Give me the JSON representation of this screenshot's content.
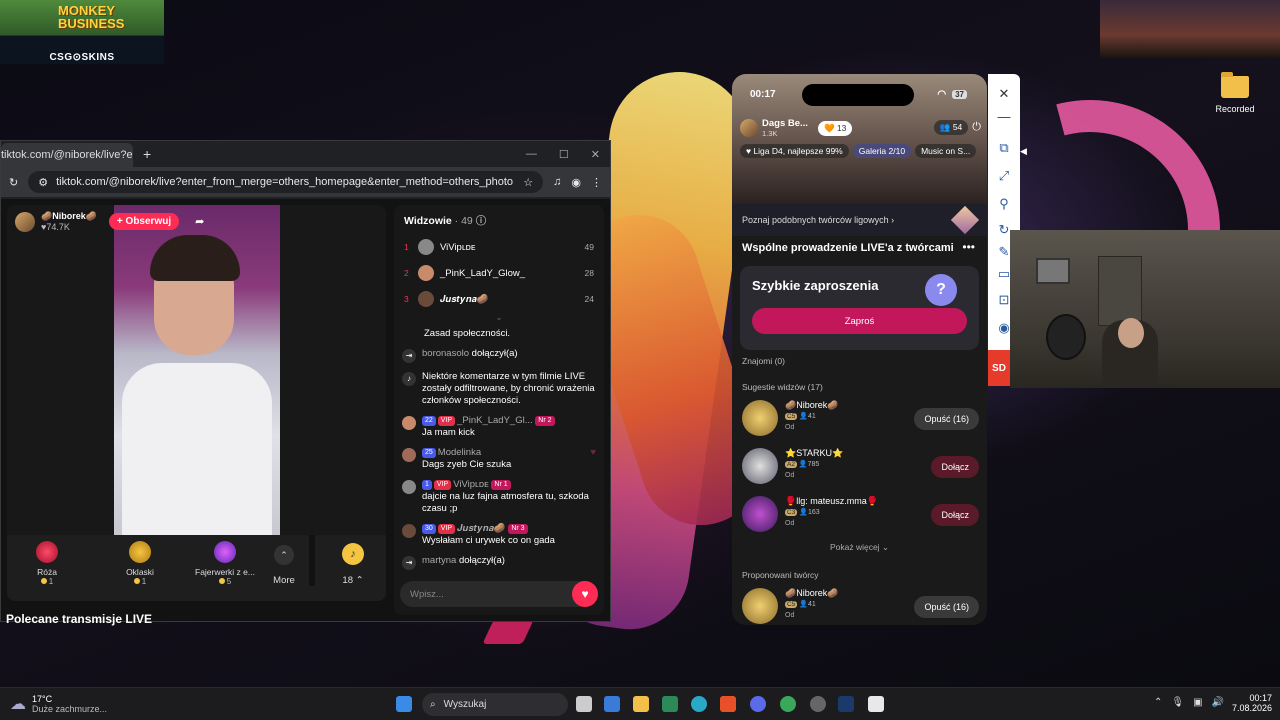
{
  "thumb_top_left": {
    "title_line1": "MONKEY",
    "title_line2": "BUSINESS",
    "brand": "CSG⊙SKINS"
  },
  "desktop_icon": {
    "label": "Recorded"
  },
  "browser": {
    "tab_title": "tiktok.com/@niborek/live?e",
    "new_tab": "+",
    "window_controls": [
      "—",
      "☐",
      "✕"
    ],
    "url": "tiktok.com/@niborek/live?enter_from_merge=others_homepage&enter_method=others_photo"
  },
  "live": {
    "host_name": "🥔Niborek🥔",
    "host_likes": "♥74.7K",
    "follow_label": "+ Obserwuj",
    "gifts": [
      {
        "name": "Róża",
        "cost": "1"
      },
      {
        "name": "Oklaski",
        "cost": "1"
      },
      {
        "name": "Fajerwerki z e...",
        "cost": "5"
      }
    ],
    "more_label": "More",
    "coins": "18",
    "recommended_label": "Polecane transmisje LIVE"
  },
  "chat": {
    "header": "Widzowie",
    "viewer_count": "· 49",
    "top_viewers": [
      {
        "rank": "1",
        "name": "ViVipʟᴅᴇ",
        "value": "49"
      },
      {
        "rank": "2",
        "name": "_PinK_LadY_Glow_",
        "value": "28"
      },
      {
        "rank": "3",
        "name": "𝑱𝒖𝒔𝒕𝒚𝒏𝒂🥔",
        "value": "24"
      }
    ],
    "messages": [
      {
        "user": "",
        "text": "Zasad społeczności."
      },
      {
        "user": "boronasolo",
        "text": "dołączył(a)"
      },
      {
        "user": "",
        "text": "Niektóre komentarze w tym filmie LIVE zostały odfiltrowane, by chronić wrażenia członków społeczności."
      },
      {
        "user": "_PinK_LadY_Gl...",
        "badges": [
          "22",
          "VIP",
          "Nr 2"
        ],
        "text": "Ja mam kick"
      },
      {
        "user": "Modelinka",
        "badges": [
          "25"
        ],
        "text": "Dags zyeb Cie szuka"
      },
      {
        "user": "ViVipʟᴅᴇ",
        "badges": [
          "1",
          "VIP",
          "Nr 1"
        ],
        "text": "dajcie na luz fajna atmosfera tu, szkoda czasu ;p"
      },
      {
        "user": "𝑱𝒖𝒔𝒕𝒚𝒏𝒂🥔",
        "badges": [
          "30",
          "VIP",
          "Nr 3"
        ],
        "text": "Wysłałam ci urywek co on gada"
      },
      {
        "user": "martyna",
        "text": "dołączył(a)"
      }
    ],
    "input_placeholder": "Wpisz..."
  },
  "phone": {
    "time": "00:17",
    "battery": "37",
    "host_name": "Dags Be...",
    "host_likes": "1.3K",
    "hearts": "13",
    "viewers": "54",
    "league": "Liga D4, najlepsze 99%",
    "gallery_label": "Galeria",
    "gallery_count": "2/10",
    "music": "Music on S...",
    "similar_creators": "Poznaj podobnych twórców ligowych",
    "sheet_title": "Wspólne prowadzenie LIVE'a z twórcami",
    "quick_invites": "Szybkie zaproszenia",
    "invite_button": "Zaproś",
    "friends": "Znajomi (0)",
    "suggestions_title": "Sugestie widzów (17)",
    "suggestions": [
      {
        "name": "🥔Niborek🥔",
        "level": "C5",
        "count": "41",
        "od": "Od",
        "action": "Opuść (16)"
      },
      {
        "name": "⭐STARKU⭐",
        "level": "A2",
        "count": "785",
        "od": "Od",
        "action": "Dołącz"
      },
      {
        "name": "🥊llg: mateusz.mma🥊",
        "level": "C3",
        "count": "163",
        "od": "Od",
        "action": "Dołącz"
      }
    ],
    "show_more": "Pokaż więcej",
    "proposed_title": "Proponowani twórcy",
    "proposed": [
      {
        "name": "🥔Niborek🥔",
        "level": "C5",
        "count": "41",
        "od": "Od",
        "action": "Opuść (16)"
      }
    ]
  },
  "sd_label": "SD",
  "taskbar": {
    "temp": "17°C",
    "weather": "Duże zachmurze...",
    "search_label": "Wyszukaj",
    "time": "00:17",
    "date": "7.08.2026"
  }
}
